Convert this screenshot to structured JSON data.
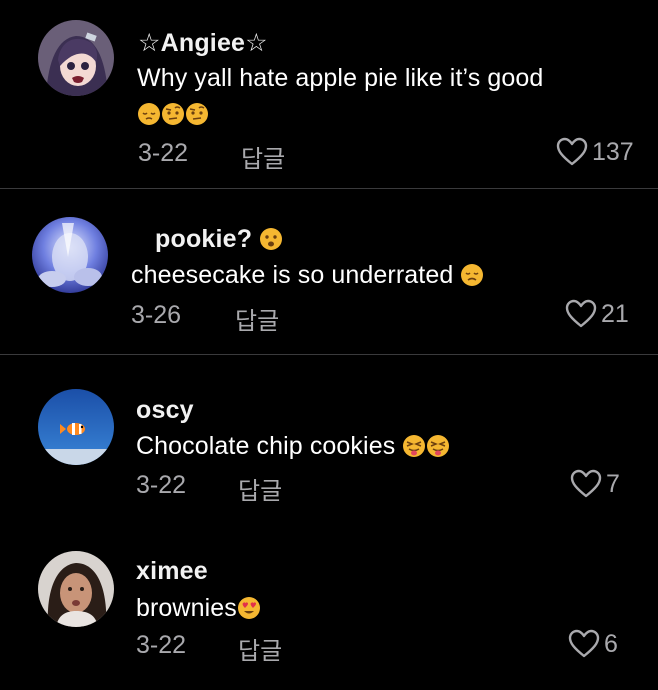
{
  "comments": [
    {
      "username": "☆Angiee☆",
      "text": "Why yall hate apple pie like it’s good",
      "emojis": [
        "pensive-face",
        "face-with-raised-eyebrow",
        "face-with-raised-eyebrow"
      ],
      "date": "3-22",
      "reply_label": "답글",
      "likes": "137"
    },
    {
      "username": "pookie?",
      "username_emoji": "frowning-face",
      "text": "cheesecake is so underrated",
      "emojis": [
        "disappointed-face"
      ],
      "date": "3-26",
      "reply_label": "답글",
      "likes": "21"
    },
    {
      "username": "oscy",
      "text": "Chocolate chip cookies",
      "emojis": [
        "squinting-face-with-tongue",
        "squinting-face-with-tongue"
      ],
      "date": "3-22",
      "reply_label": "답글",
      "likes": "7"
    },
    {
      "username": "ximee",
      "text": "brownies",
      "emojis": [
        "smiling-face-with-heart-eyes"
      ],
      "date": "3-22",
      "reply_label": "답글",
      "likes": "6"
    }
  ],
  "colors": {
    "background": "#000000",
    "text": "#ffffff",
    "secondary_text": "#a9a9ad",
    "divider": "#3a3a3c",
    "emoji_yellow": "#f5b731"
  },
  "icons": {
    "like": "heart-outline-icon"
  }
}
